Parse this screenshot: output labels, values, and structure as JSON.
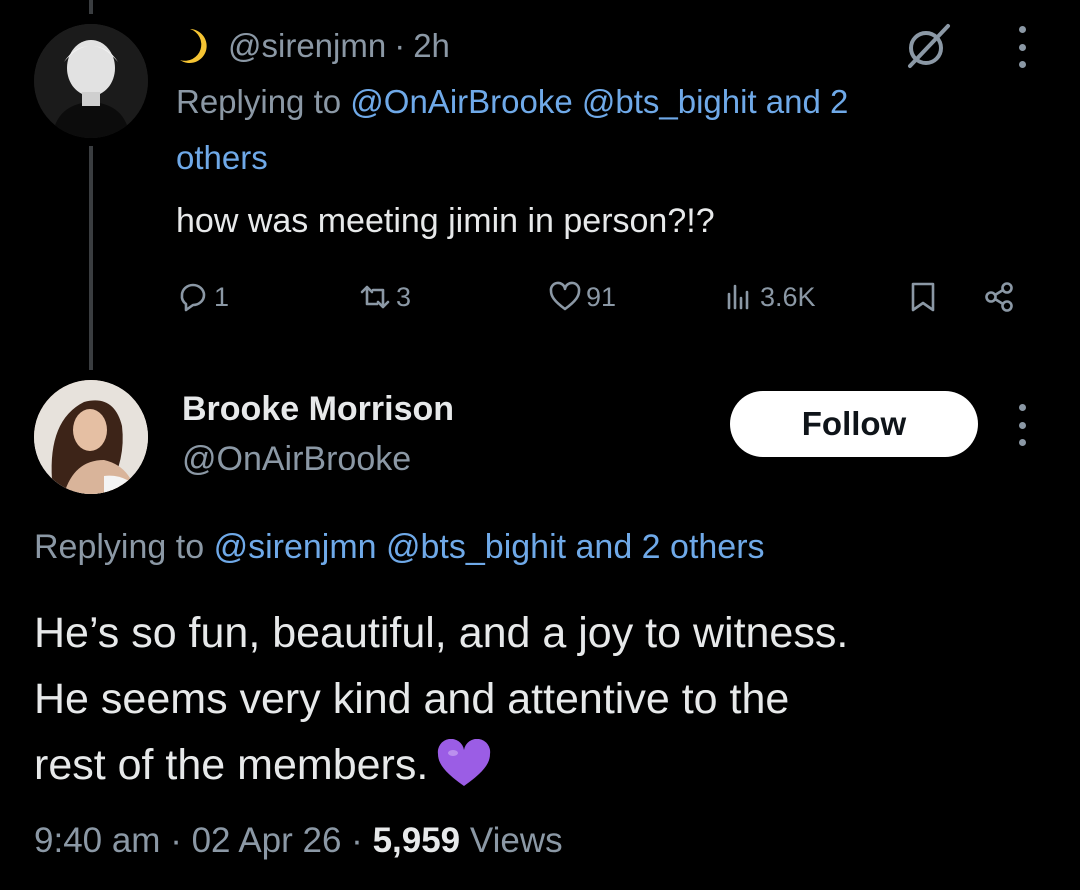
{
  "tweet1": {
    "handle": "@sirenjmn",
    "separator": "·",
    "time_ago": "2h",
    "replying_prefix": "Replying to",
    "replying_mentions": "@OnAirBrooke @bts_bighit and 2",
    "replying_others": "others",
    "body": "how was meeting jimin in person?!?",
    "actions": {
      "replies": "1",
      "retweets": "3",
      "likes": "91",
      "views": "3.6K"
    },
    "icons": {
      "name_emoji": "crescent-moon-icon",
      "grok": "grok-icon",
      "more": "more-vertical-icon",
      "reply": "reply-icon",
      "retweet": "retweet-icon",
      "like": "heart-icon",
      "views": "views-icon",
      "bookmark": "bookmark-icon",
      "share": "share-icon"
    }
  },
  "tweet2": {
    "display_name": "Brooke Morrison",
    "handle": "@OnAirBrooke",
    "follow_label": "Follow",
    "replying_prefix": "Replying to",
    "replying_mentions": "@sirenjmn @bts_bighit and 2 others",
    "body_line1": "He’s so fun, beautiful, and a joy to witness.",
    "body_line2": "He seems very kind and attentive to the",
    "body_line3": "rest of the members.",
    "emoji": "purple-heart-icon",
    "time": "9:40 am",
    "date": "02 Apr 26",
    "views_count": "5,959",
    "views_label": "Views"
  },
  "colors": {
    "background": "#000000",
    "text_primary": "#e7e9ea",
    "text_secondary": "#8b98a5",
    "link": "#6fa9e8",
    "follow_bg": "#ffffff",
    "emoji_purple": "#9b5de5"
  }
}
